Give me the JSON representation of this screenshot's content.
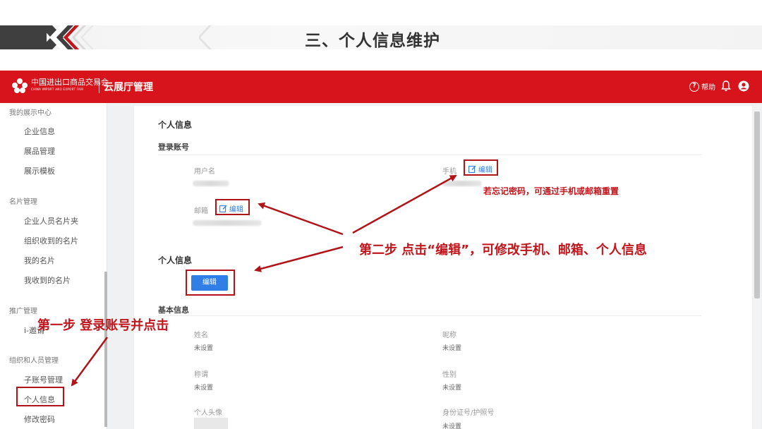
{
  "slide": {
    "title": "三、个人信息维护"
  },
  "header": {
    "logo_text": "中国进出口商品交易会",
    "logo_sub": "CHINA IMPORT AND EXPORT FAIR",
    "app_title": "云展厅管理",
    "help_label": "帮助"
  },
  "sidebar": {
    "groups": [
      {
        "label": "我的展示中心"
      },
      {
        "label": "名片管理"
      },
      {
        "label": "推广管理"
      },
      {
        "label": "组织和人员管理"
      }
    ],
    "items": [
      {
        "label": "企业信息"
      },
      {
        "label": "展品管理"
      },
      {
        "label": "展示模板"
      },
      {
        "label": "企业人员名片夹"
      },
      {
        "label": "组织收到的名片"
      },
      {
        "label": "我的名片"
      },
      {
        "label": "我收到的名片"
      },
      {
        "label": "i-邀请"
      },
      {
        "label": "子账号管理"
      },
      {
        "label": "个人信息"
      },
      {
        "label": "修改密码"
      }
    ]
  },
  "content": {
    "page_heading": "个人信息",
    "login_section": "登录账号",
    "username_label": "用户名",
    "phone_label": "手机",
    "email_label": "邮箱",
    "edit_label": "编辑",
    "personal_heading": "个人信息",
    "edit_button": "编辑",
    "basic_heading": "基本信息",
    "fields": [
      {
        "label": "姓名",
        "value": "未设置"
      },
      {
        "label": "昵称",
        "value": "未设置"
      },
      {
        "label": "称谓",
        "value": "未设置"
      },
      {
        "label": "性别",
        "value": "未设置"
      },
      {
        "label": "个人头像",
        "value": ""
      },
      {
        "label": "身份证号/护照号",
        "value": "未设置"
      }
    ]
  },
  "annotations": {
    "forgot_password": "若忘记密码，可通过手机或邮箱重置",
    "step_two": "第二步   点击“编辑”，可修改手机、邮箱、个人信息",
    "step_one": "第一步   登录账号并点击",
    "accent_color": "#c0161c"
  }
}
